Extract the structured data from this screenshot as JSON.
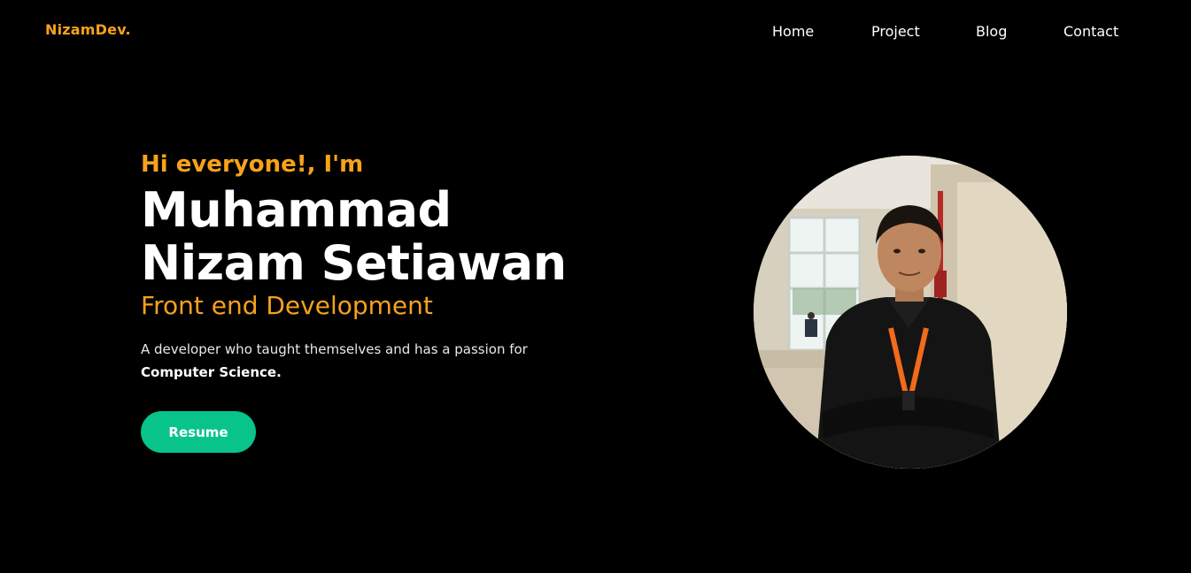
{
  "header": {
    "logo": "NizamDev.",
    "nav": [
      "Home",
      "Project",
      "Blog",
      "Contact"
    ]
  },
  "hero": {
    "greeting": "Hi everyone!, I'm",
    "name_line1": "Muhammad",
    "name_line2": "Nizam Setiawan",
    "role": "Front end Development",
    "description": "A developer who taught themselves and has a passion for",
    "description_bold": "Computer Science.",
    "cta_label": "Resume"
  },
  "colors": {
    "background": "#000000",
    "accent": "#f7a21b",
    "button": "#08c48a",
    "text": "#ffffff"
  }
}
